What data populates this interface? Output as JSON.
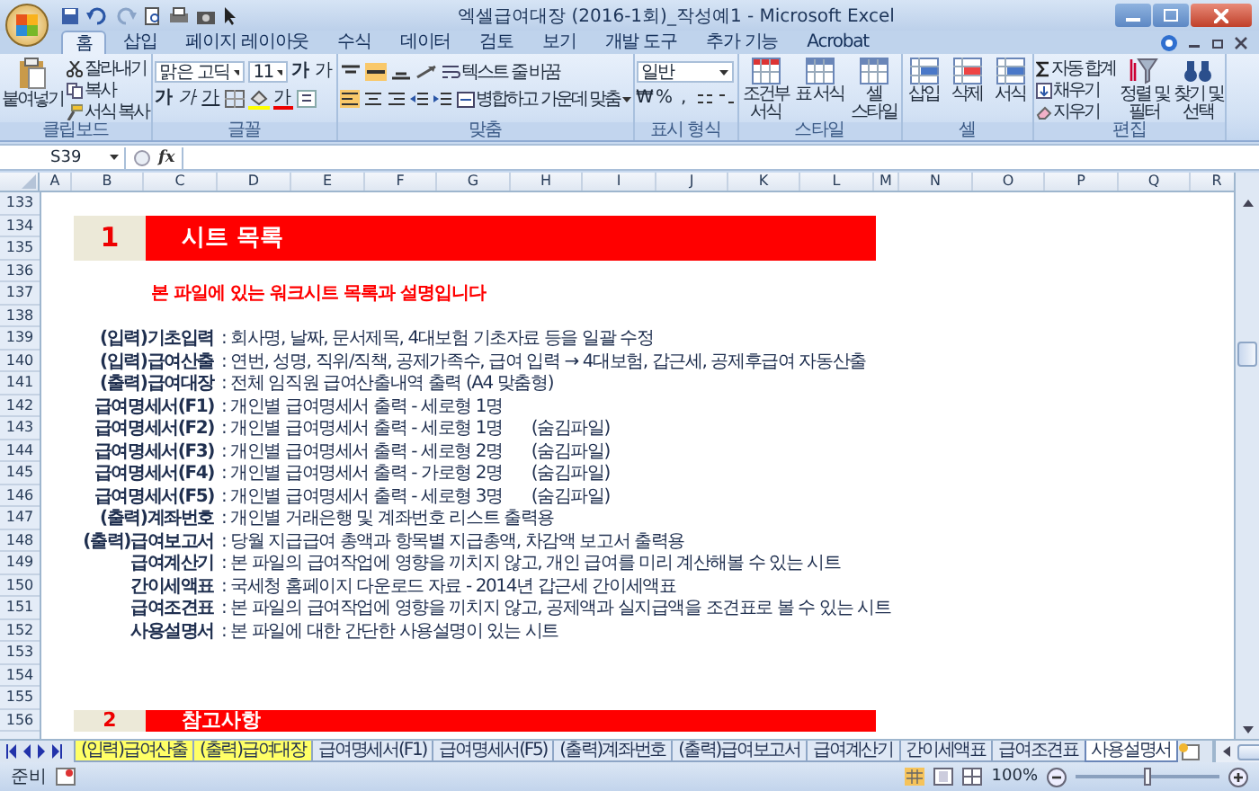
{
  "window": {
    "title": "엑셀급여대장 (2016-1회)_작성예1 - Microsoft Excel"
  },
  "ribbon": {
    "tabs": [
      {
        "label": "홈",
        "selected": true
      },
      {
        "label": "삽입",
        "selected": false
      },
      {
        "label": "페이지 레이아웃",
        "selected": false
      },
      {
        "label": "수식",
        "selected": false
      },
      {
        "label": "데이터",
        "selected": false
      },
      {
        "label": "검토",
        "selected": false
      },
      {
        "label": "보기",
        "selected": false
      },
      {
        "label": "개발 도구",
        "selected": false
      },
      {
        "label": "추가 기능",
        "selected": false
      },
      {
        "label": "Acrobat",
        "selected": false
      }
    ],
    "clipboard": {
      "label": "클립보드",
      "paste": "붙여넣기",
      "cut": "잘라내기",
      "copy": "복사",
      "format_painter": "서식 복사"
    },
    "font": {
      "label": "글꼴",
      "name": "맑은 고딕",
      "size": "11",
      "grow": "가",
      "shrink": "가",
      "styles": [
        "가",
        "가",
        "가"
      ],
      "color_glyph": "가"
    },
    "alignment": {
      "label": "맞춤",
      "wrap": "텍스트 줄 바꿈",
      "merge": "병합하고 가운데 맞춤"
    },
    "number": {
      "label": "표시 형식",
      "format": "일반",
      "symbols": [
        "₩",
        "%",
        ","
      ]
    },
    "styles": {
      "label": "스타일",
      "buttons": [
        "조건부 서식",
        "표 서식",
        "셀 스타일"
      ]
    },
    "cells": {
      "label": "셀",
      "buttons": [
        "삽입",
        "삭제",
        "서식"
      ]
    },
    "editing": {
      "label": "편집",
      "autosum": "자동 합계",
      "fill": "채우기",
      "clear": "지우기",
      "sort": "정렬 및 필터",
      "find": "찾기 및 선택"
    }
  },
  "formula_bar": {
    "name_box": "S39",
    "function_label": "fx"
  },
  "sheet": {
    "columns": [
      "A",
      "B",
      "C",
      "D",
      "E",
      "F",
      "G",
      "H",
      "I",
      "J",
      "K",
      "L",
      "M",
      "N",
      "O",
      "P",
      "Q",
      "R"
    ],
    "rows": [
      "133",
      "134",
      "135",
      "136",
      "137",
      "138",
      "139",
      "140",
      "141",
      "142",
      "143",
      "144",
      "145",
      "146",
      "147",
      "148",
      "149",
      "150",
      "151",
      "152",
      "153",
      "154",
      "155",
      "156"
    ],
    "section_1": {
      "number": "1",
      "title": "시트 목록"
    },
    "intro": "본 파일에 있는 워크시트 목록과 설명입니다",
    "entries": [
      {
        "name": "(입력)기초입력",
        "description": ": 회사명, 날짜, 문서제목, 4대보험 기초자료 등을 일괄 수정"
      },
      {
        "name": "(입력)급여산출",
        "description": ": 연번, 성명, 직위/직책, 공제가족수, 급여 입력 → 4대보험, 갑근세, 공제후급여 자동산출"
      },
      {
        "name": "(출력)급여대장",
        "description": ": 전체 임직원 급여산출내역 출력 (A4 맞춤형)"
      },
      {
        "name": "급여명세서(F1)",
        "description": ": 개인별 급여명세서 출력 - 세로형 1명"
      },
      {
        "name": "급여명세서(F2)",
        "description": ": 개인별 급여명세서 출력 - 세로형 1명",
        "note": "(숨김파일)"
      },
      {
        "name": "급여명세서(F3)",
        "description": ": 개인별 급여명세서 출력 - 세로형 2명",
        "note": "(숨김파일)"
      },
      {
        "name": "급여명세서(F4)",
        "description": ": 개인별 급여명세서 출력 - 가로형 2명",
        "note": "(숨김파일)"
      },
      {
        "name": "급여명세서(F5)",
        "description": ": 개인별 급여명세서 출력 - 세로형 3명",
        "note": "(숨김파일)"
      },
      {
        "name": "(출력)계좌번호",
        "description": ": 개인별 거래은행 및 계좌번호 리스트 출력용"
      },
      {
        "name": "(출력)급여보고서",
        "description": ": 당월 지급급여 총액과 항목별 지급총액, 차감액 보고서 출력용"
      },
      {
        "name": "급여계산기",
        "description": ": 본 파일의 급여작업에 영향을 끼치지 않고, 개인 급여를 미리 계산해볼 수 있는 시트"
      },
      {
        "name": "간이세액표",
        "description": ": 국세청 홈페이지 다운로드 자료 - 2014년 갑근세 간이세액표"
      },
      {
        "name": "급여조견표",
        "description": ": 본 파일의 급여작업에 영향을 끼치지 않고, 공제액과 실지급액을 조견표로 볼 수 있는 시트"
      },
      {
        "name": "사용설명서",
        "description": ": 본 파일에 대한 간단한 사용설명이 있는 시트"
      }
    ],
    "section_2": {
      "number": "2",
      "title": "참고사항"
    }
  },
  "sheet_tabs": [
    {
      "label": "(입력)급여산출",
      "selected": false,
      "color": "#ffff66"
    },
    {
      "label": "(출력)급여대장",
      "selected": false,
      "color": "#ffff66"
    },
    {
      "label": "급여명세서(F1)",
      "selected": false,
      "color": "#dfe8f5"
    },
    {
      "label": "급여명세서(F5)",
      "selected": false,
      "color": "#dfe8f5"
    },
    {
      "label": "(출력)계좌번호",
      "selected": false,
      "color": "#dfe8f5"
    },
    {
      "label": "(출력)급여보고서",
      "selected": false,
      "color": "#dfe8f5"
    },
    {
      "label": "급여계산기",
      "selected": false,
      "color": "#dfe8f5"
    },
    {
      "label": "간이세액표",
      "selected": false,
      "color": "#dfe8f5"
    },
    {
      "label": "급여조견표",
      "selected": false,
      "color": "#dfe8f5"
    },
    {
      "label": "사용설명서",
      "selected": true,
      "color": "#ffffff"
    }
  ],
  "status_bar": {
    "mode": "준비",
    "zoom": "100%",
    "zoom_slider": {
      "level": 0.5
    }
  }
}
